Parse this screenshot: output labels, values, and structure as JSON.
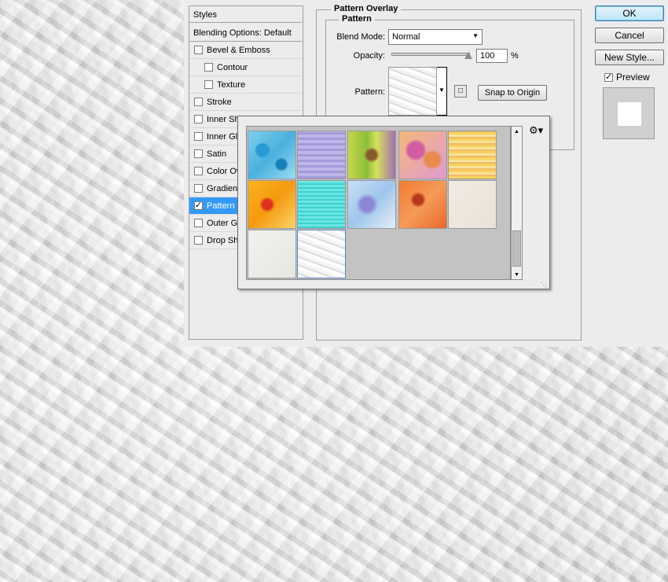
{
  "styles_panel": {
    "title": "Styles",
    "blending_options": "Blending Options: Default",
    "items": [
      {
        "label": "Bevel & Emboss",
        "checked": false
      },
      {
        "label": "Contour",
        "checked": false
      },
      {
        "label": "Texture",
        "checked": false
      },
      {
        "label": "Stroke",
        "checked": false
      },
      {
        "label": "Inner Sh",
        "checked": false
      },
      {
        "label": "Inner Gl",
        "checked": false
      },
      {
        "label": "Satin",
        "checked": false
      },
      {
        "label": "Color Ove",
        "checked": false
      },
      {
        "label": "Gradient",
        "checked": false
      },
      {
        "label": "Pattern C",
        "checked": true
      },
      {
        "label": "Outer Gl",
        "checked": false
      },
      {
        "label": "Drop Sha",
        "checked": false
      }
    ]
  },
  "pattern_overlay": {
    "section_title": "Pattern Overlay",
    "group_title": "Pattern",
    "blend_mode_label": "Blend Mode:",
    "blend_mode_value": "Normal",
    "opacity_label": "Opacity:",
    "opacity_value": "100",
    "opacity_unit": "%",
    "opacity_level": 1.0,
    "pattern_label": "Pattern:",
    "snap_button": "Snap to Origin"
  },
  "buttons": {
    "ok": "OK",
    "cancel": "Cancel",
    "new_style": "New Style...",
    "preview": "Preview"
  },
  "preview_checked": true,
  "pattern_picker": {
    "tiles": [
      "blue watercolor",
      "purple linen",
      "green watercolor",
      "pink watercolor",
      "yellow stripes",
      "orange watercolor",
      "cyan linen",
      "lavender watercolor",
      "red-orange watercolor",
      "beige paper",
      "white paper",
      "crumpled paper"
    ],
    "selected_index": 11,
    "menu_icon": "gear-icon"
  },
  "colors": {
    "selection": "#3399ff",
    "dialog_bg": "#ececec"
  }
}
